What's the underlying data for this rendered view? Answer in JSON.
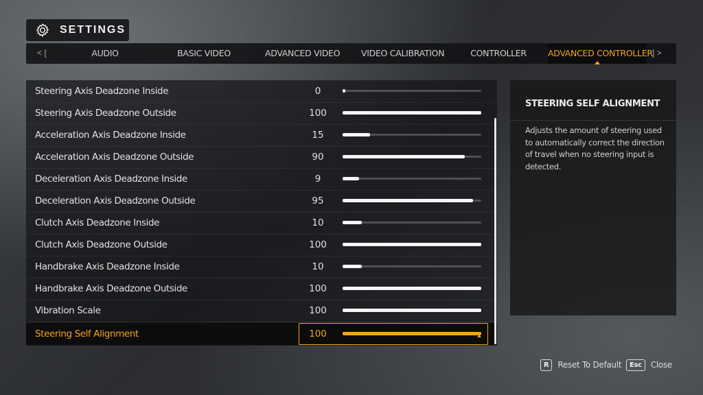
{
  "header": {
    "title": "SETTINGS",
    "icon": "gear-icon"
  },
  "tabs": {
    "prev": "<  [",
    "next": "]  >",
    "items": [
      {
        "label": "AUDIO",
        "active": false
      },
      {
        "label": "BASIC VIDEO",
        "active": false
      },
      {
        "label": "ADVANCED VIDEO",
        "active": false
      },
      {
        "label": "VIDEO CALIBRATION",
        "active": false
      },
      {
        "label": "CONTROLLER",
        "active": false
      },
      {
        "label": "ADVANCED CONTROLLER",
        "active": true
      }
    ]
  },
  "settings": [
    {
      "label": "Steering Axis Deadzone Inside",
      "value": "0",
      "fraction": 0.0
    },
    {
      "label": "Steering Axis Deadzone Outside",
      "value": "100",
      "fraction": 1.0
    },
    {
      "label": "Acceleration Axis Deadzone Inside",
      "value": "15",
      "fraction": 0.2
    },
    {
      "label": "Acceleration Axis Deadzone Outside",
      "value": "90",
      "fraction": 0.88
    },
    {
      "label": "Deceleration Axis Deadzone Inside",
      "value": "9",
      "fraction": 0.12
    },
    {
      "label": "Deceleration Axis Deadzone Outside",
      "value": "95",
      "fraction": 0.94
    },
    {
      "label": "Clutch Axis Deadzone Inside",
      "value": "10",
      "fraction": 0.14
    },
    {
      "label": "Clutch Axis Deadzone Outside",
      "value": "100",
      "fraction": 1.0
    },
    {
      "label": "Handbrake Axis Deadzone Inside",
      "value": "10",
      "fraction": 0.14
    },
    {
      "label": "Handbrake Axis Deadzone Outside",
      "value": "100",
      "fraction": 1.0
    },
    {
      "label": "Vibration Scale",
      "value": "100",
      "fraction": 1.0
    },
    {
      "label": "Steering Self Alignment",
      "value": "100",
      "fraction": 1.0,
      "selected": true
    }
  ],
  "description": {
    "title": "STEERING SELF ALIGNMENT",
    "text": "Adjusts the amount of steering used to automatically correct the direction of travel when no steering input is detected."
  },
  "footer": {
    "reset_key": "R",
    "reset_label": "Reset To Default",
    "close_key": "Esc",
    "close_label": "Close"
  },
  "colors": {
    "accent": "#f4a51c",
    "bar": "#f5f5f5"
  }
}
